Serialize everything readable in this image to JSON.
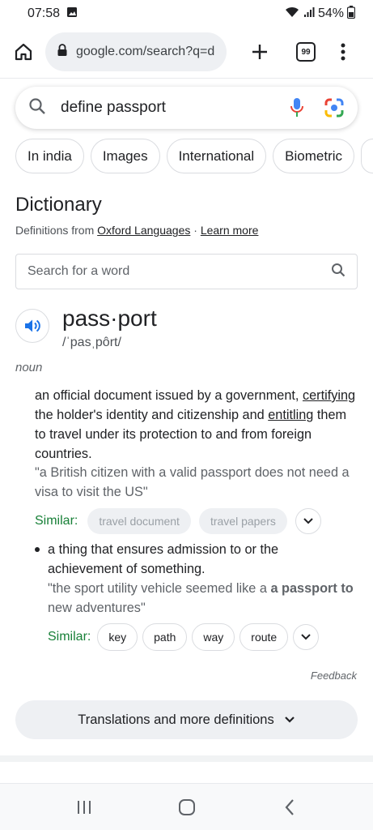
{
  "status": {
    "time": "07:58",
    "battery": "54%"
  },
  "browser": {
    "url": "google.com/search?q=def",
    "tab_count": "99"
  },
  "search": {
    "query": "define passport"
  },
  "chips": [
    "In india",
    "Images",
    "International",
    "Biometric"
  ],
  "dictionary": {
    "title": "Dictionary",
    "source_prefix": "Definitions from ",
    "source": "Oxford Languages",
    "separator": " · ",
    "learn_more": "Learn more",
    "search_placeholder": "Search for a word",
    "headword": "pass·port",
    "phonetic": "/ˈpasˌpôrt/",
    "pos": "noun",
    "def1": {
      "pre": "an official document issued by a government, ",
      "link1": "certifying",
      "mid": " the holder's identity and citizenship and ",
      "link2": "entitling",
      "post": " them to travel under its protection to and from foreign countries."
    },
    "example1": "\"a British citizen with a valid passport does not need a visa to visit the US\"",
    "similar_label": "Similar:",
    "similar1": [
      "travel document",
      "travel papers"
    ],
    "def2": "a thing that ensures admission to or the achievement of something.",
    "example2": {
      "pre": "\"the sport utility vehicle seemed like a ",
      "bold": "a passport to",
      "post": " new adventures\""
    },
    "similar2": [
      "key",
      "path",
      "way",
      "route"
    ],
    "feedback": "Feedback",
    "more_button": "Translations and more definitions"
  },
  "colors": {
    "accent_blue": "#1a73e8",
    "similar_green": "#188038"
  }
}
